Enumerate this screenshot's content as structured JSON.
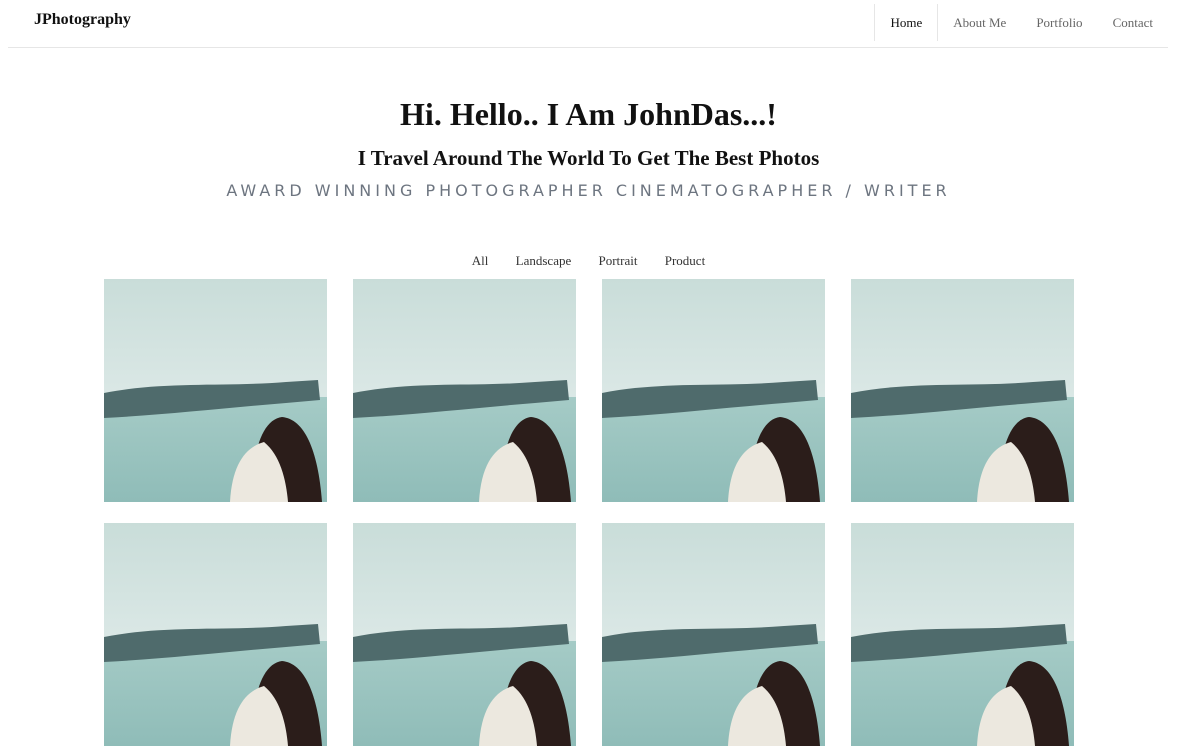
{
  "nav": {
    "brand": "JPhotography",
    "items": [
      {
        "label": "Home",
        "active": true
      },
      {
        "label": "About Me",
        "active": false
      },
      {
        "label": "Portfolio",
        "active": false
      },
      {
        "label": "Contact",
        "active": false
      }
    ]
  },
  "hero": {
    "title": "Hi. Hello.. I Am JohnDas...!",
    "subtitle": "I Travel Around The World To Get The Best Photos",
    "tagline": "AWARD WINNING PHOTOGRAPHER CINEMATOGRAPHER / WRITER"
  },
  "filters": [
    "All",
    "Landscape",
    "Portrait",
    "Product"
  ],
  "gallery": {
    "photo_count": 8,
    "colors": {
      "sky": "#dbe8e6",
      "sea": "#8fbcb8",
      "blindfold": "#4f6b6c",
      "hair": "#2b1d1a",
      "shirt": "#ece8df"
    }
  }
}
